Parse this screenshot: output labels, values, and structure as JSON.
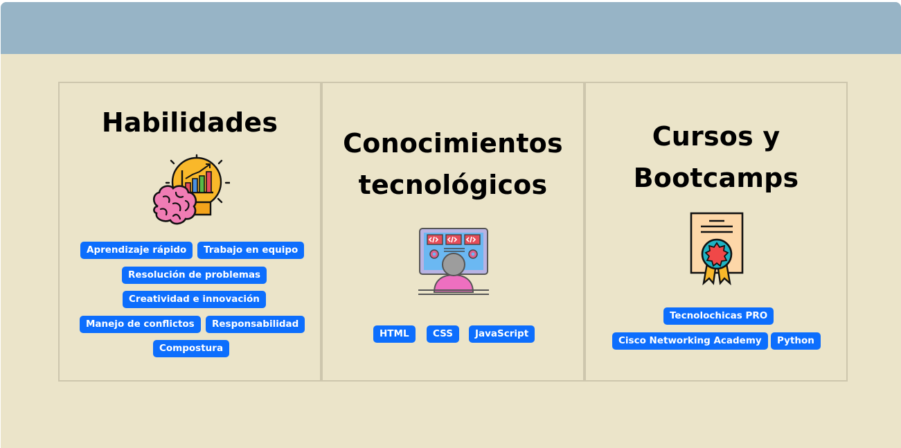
{
  "header": {},
  "cards": [
    {
      "title": "Habilidades",
      "icon": "brain-lightbulb-chart-icon",
      "badges": [
        "Aprendizaje rápido",
        "Trabajo en equipo",
        "Resolución de problemas",
        "Creatividad e innovación",
        "Manejo de conflictos",
        "Responsabilidad",
        "Compostura"
      ]
    },
    {
      "title_line1": "Conocimientos",
      "title_line2": "tecnológicos",
      "icon": "developer-monitor-icon",
      "badges": [
        "HTML",
        "CSS",
        "JavaScript"
      ]
    },
    {
      "title_line1": "Cursos y",
      "title_line2": "Bootcamps",
      "icon": "certificate-icon",
      "badges": [
        "Tecnolochicas PRO",
        "Cisco Networking Academy",
        "Python"
      ]
    }
  ],
  "colors": {
    "header": "#97b4c6",
    "background": "#ebe4c9",
    "badge": "#0d6efd",
    "card_border": "#cdc6ad"
  }
}
